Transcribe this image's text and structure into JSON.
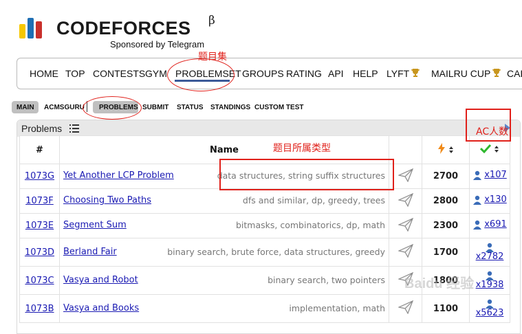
{
  "logo": {
    "title": "CODEFORCES",
    "beta": "β",
    "sponsor": "Sponsored by Telegram"
  },
  "menu": {
    "items": [
      "HOME",
      "TOP",
      "CONTESTS",
      "GYM",
      "PROBLEMSET",
      "GROUPS",
      "RATING",
      "API",
      "HELP",
      "LYFT",
      "MAILRU CUP",
      "CAL"
    ],
    "active": "PROBLEMSET"
  },
  "subnav": {
    "items": [
      "MAIN",
      "ACMSGURU",
      "PROBLEMS",
      "SUBMIT",
      "STATUS",
      "STANDINGS",
      "CUSTOM TEST"
    ],
    "active": [
      "MAIN",
      "PROBLEMS"
    ]
  },
  "panel": {
    "title": "Problems"
  },
  "table": {
    "headers": {
      "id": "#",
      "name": "Name"
    },
    "rows": [
      {
        "id": "1073G",
        "name": "Yet Another LCP Problem",
        "tags": "data structures, string suffix structures",
        "difficulty": "2700",
        "solved": "x107"
      },
      {
        "id": "1073F",
        "name": "Choosing Two Paths",
        "tags": "dfs and similar, dp, greedy, trees",
        "difficulty": "2800",
        "solved": "x130"
      },
      {
        "id": "1073E",
        "name": "Segment Sum",
        "tags": "bitmasks, combinatorics, dp, math",
        "difficulty": "2300",
        "solved": "x691"
      },
      {
        "id": "1073D",
        "name": "Berland Fair",
        "tags": "binary search, brute force, data structures, greedy",
        "difficulty": "1700",
        "solved": "x2782"
      },
      {
        "id": "1073C",
        "name": "Vasya and Robot",
        "tags": "binary search, two pointers",
        "difficulty": "1800",
        "solved": "x1938"
      },
      {
        "id": "1073B",
        "name": "Vasya and Books",
        "tags": "implementation, math",
        "difficulty": "1100",
        "solved": "x5623"
      }
    ]
  },
  "annotations": {
    "problemset": "题目集",
    "ac_count": "AC人数",
    "problem_type": "题目所属类型"
  },
  "watermark": "Baidu 经验",
  "colors": {
    "accent_blue": "#3b5998",
    "annotation_red": "#e0201a",
    "link": "#1a1ab3"
  }
}
